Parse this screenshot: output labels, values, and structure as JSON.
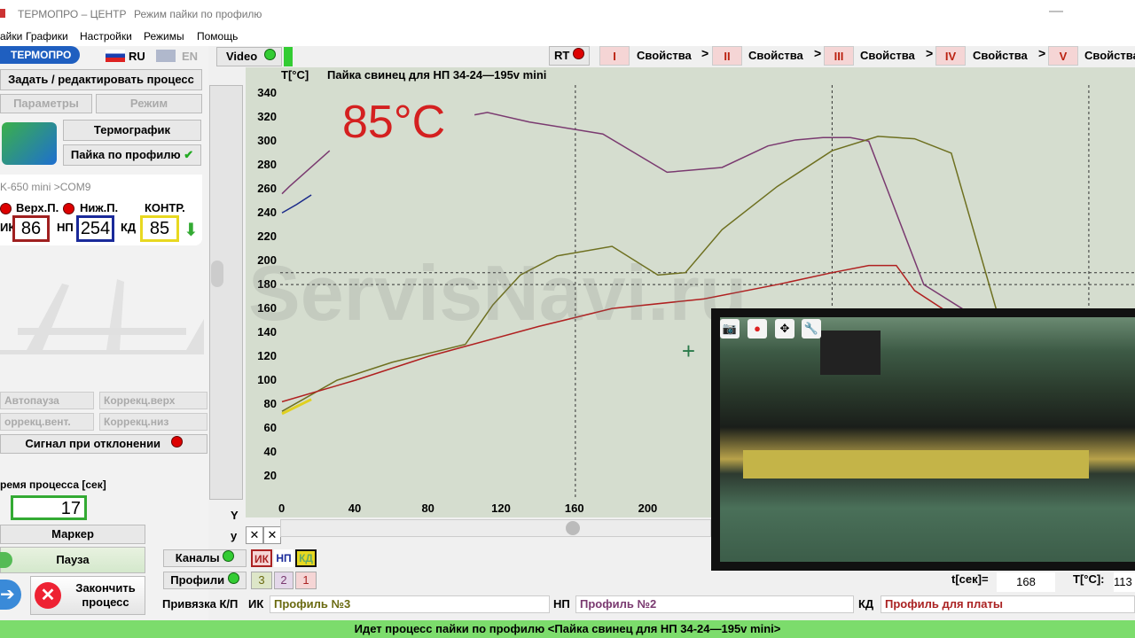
{
  "window": {
    "app_title": "ТЕРМОПРО – ЦЕНТР",
    "subtitle": "Режим пайки по профилю",
    "minimize": "—"
  },
  "menu": [
    "айки",
    "Графики",
    "Настройки",
    "Режимы",
    "Помощь"
  ],
  "left": {
    "logo": "ТЕРМОПРО",
    "lang_ru": "RU",
    "lang_en": "EN",
    "edit_process": "Задать / редактировать процесс",
    "params": "Параметры",
    "mode": "Режим",
    "thermograph": "Термографик",
    "profile_solder": "Пайка по профилю",
    "device": "K-650 mini >COM9",
    "top_heater": "Верх.П.",
    "bottom_heater": "Ниж.П.",
    "control": "КОНТР.",
    "ik": "ИК",
    "np": "НП",
    "kd": "КД",
    "ik_val": "86",
    "np_val": "254",
    "kd_val": "85",
    "autopause": "Автопауза",
    "corr_top": "Коррекц.верх",
    "corr_fan": "оррекц.вент.",
    "corr_bottom": "Коррекц.низ",
    "signal": "Сигнал при отклонении",
    "process_time_label": "ремя процесса [сек]",
    "process_time": "17",
    "marker": "Маркер",
    "pause": "Пауза",
    "finish": "Закончить процесс"
  },
  "top": {
    "video": "Video",
    "rt": "RT",
    "tabs": [
      {
        "num": "I",
        "label": "Свойства"
      },
      {
        "num": "II",
        "label": "Свойства"
      },
      {
        "num": "III",
        "label": "Свойства"
      },
      {
        "num": "IV",
        "label": "Свойства"
      },
      {
        "num": "V",
        "label": "Свойства"
      }
    ]
  },
  "chart_data": {
    "type": "line",
    "title": "Пайка свинец для НП 34-24—195v mini",
    "ylabel": "T[°C]",
    "xlim": [
      0,
      260
    ],
    "ylim": [
      0,
      340
    ],
    "x_ticks": [
      0,
      40,
      80,
      120,
      160,
      200
    ],
    "y_ticks": [
      20,
      40,
      60,
      80,
      100,
      120,
      140,
      160,
      180,
      200,
      220,
      240,
      260,
      280,
      300,
      320,
      340
    ],
    "current_temp": "85°C",
    "series": [
      {
        "color": "#7a3a70",
        "x": [
          0,
          4,
          26
        ],
        "y": [
          256,
          262,
          292
        ]
      },
      {
        "color": "#7a3a70",
        "x": [
          105,
          112,
          135,
          175,
          210,
          240,
          265,
          280,
          295,
          310,
          320,
          330,
          350,
          375,
          410
        ],
        "y": [
          322,
          324,
          316,
          306,
          274,
          278,
          296,
          301,
          303,
          303,
          300,
          260,
          180,
          156,
          80
        ]
      },
      {
        "color": "#6e7020",
        "x": [
          0,
          30,
          60,
          100,
          115,
          130,
          150,
          180,
          205,
          220,
          240,
          270,
          300,
          325,
          345,
          365,
          395
        ],
        "y": [
          74,
          100,
          115,
          130,
          163,
          188,
          204,
          212,
          188,
          190,
          226,
          262,
          292,
          304,
          302,
          290,
          130
        ]
      },
      {
        "color": "#b02020",
        "x": [
          0,
          40,
          80,
          140,
          180,
          230,
          270,
          300,
          320,
          335,
          345,
          370,
          395
        ],
        "y": [
          82,
          100,
          120,
          145,
          160,
          168,
          180,
          190,
          196,
          196,
          175,
          150,
          70
        ]
      },
      {
        "color": "#1a2a8a",
        "x": [
          0,
          8,
          16
        ],
        "y": [
          240,
          247,
          255
        ]
      },
      {
        "color": "#e0d020",
        "x": [
          0,
          8,
          16
        ],
        "y": [
          72,
          78,
          84
        ]
      }
    ],
    "x_axis_label_y": "Y",
    "x_axis_label_u": "y"
  },
  "bottom": {
    "channels": "Каналы",
    "profiles": "Профили",
    "ch_ik": "ИК",
    "ch_np": "НП",
    "ch_kd": "КД",
    "p3": "3",
    "p2": "2",
    "p1": "1",
    "binding": "Привязка К/П",
    "ik": "ИК",
    "np": "НП",
    "kd": "КД",
    "ik_profile": "Профиль №3",
    "np_profile": "Профиль №2",
    "kd_profile": "Профиль для платы",
    "t_sec_label": "t[сек]=",
    "t_sec": "168",
    "t_c_label": "T[°C]:",
    "t_c": "113"
  },
  "status": "Идет процесс пайки по профилю  <Пайка свинец для НП 34-24—195v mini>",
  "watermark": "ServisNavi.ru"
}
